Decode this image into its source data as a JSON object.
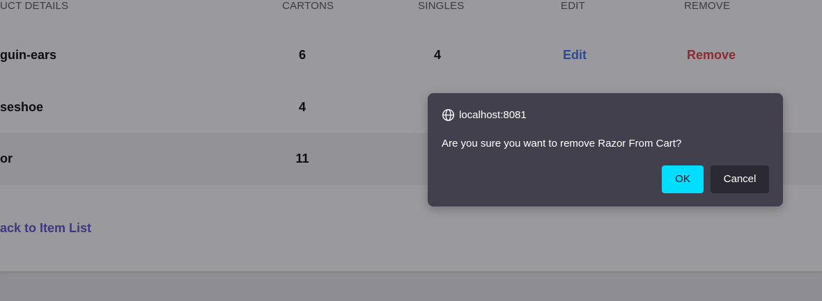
{
  "table": {
    "headers": {
      "product": "UCT DETAILS",
      "cartons": "CARTONS",
      "singles": "SINGLES",
      "edit": "EDIT",
      "remove": "REMOVE"
    },
    "rows": [
      {
        "product": "guin-ears",
        "cartons": "6",
        "singles": "4",
        "edit": "Edit",
        "remove": "Remove"
      },
      {
        "product": "seshoe",
        "cartons": "4"
      },
      {
        "product": "or",
        "cartons": "11"
      }
    ]
  },
  "back_link": "ack to Item List",
  "dialog": {
    "origin": "localhost:8081",
    "message": "Are you sure you want to remove Razor From Cart?",
    "ok_label": "OK",
    "cancel_label": "Cancel"
  },
  "colors": {
    "ok_button": "#00ddff",
    "dialog_bg": "#42404d",
    "edit_link": "#2c4a93",
    "remove_link": "#8a2b31",
    "back_link": "#3e3680"
  },
  "icons": {
    "dialog_origin": "globe-icon"
  }
}
